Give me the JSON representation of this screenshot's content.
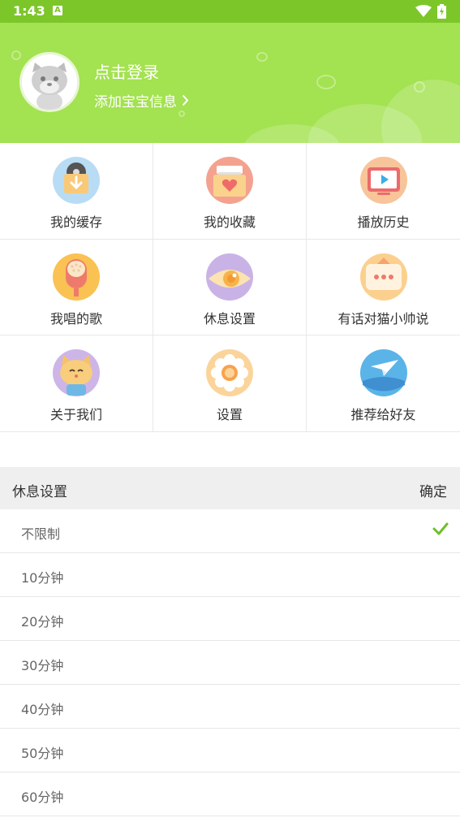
{
  "status_bar": {
    "time": "1:43",
    "notification_letter": "A"
  },
  "header": {
    "login_text": "点击登录",
    "baby_info_text": "添加宝宝信息",
    "background_color": "#a3e250"
  },
  "menu": [
    {
      "label": "我的缓存",
      "icon": "download-box-icon"
    },
    {
      "label": "我的收藏",
      "icon": "heart-folder-icon"
    },
    {
      "label": "播放历史",
      "icon": "tv-play-icon"
    },
    {
      "label": "我唱的歌",
      "icon": "microphone-icon"
    },
    {
      "label": "休息设置",
      "icon": "sleepy-eye-icon"
    },
    {
      "label": "有话对猫小帅说",
      "icon": "chat-bubble-icon"
    },
    {
      "label": "关于我们",
      "icon": "cat-face-icon"
    },
    {
      "label": "设置",
      "icon": "gear-flower-icon"
    },
    {
      "label": "推荐给好友",
      "icon": "paper-plane-icon"
    }
  ],
  "rest_sheet": {
    "title": "休息设置",
    "confirm_label": "确定",
    "selected_index": 0,
    "accent_color": "#6fbf2a",
    "options": [
      "不限制",
      "10分钟",
      "20分钟",
      "30分钟",
      "40分钟",
      "50分钟",
      "60分钟"
    ]
  }
}
